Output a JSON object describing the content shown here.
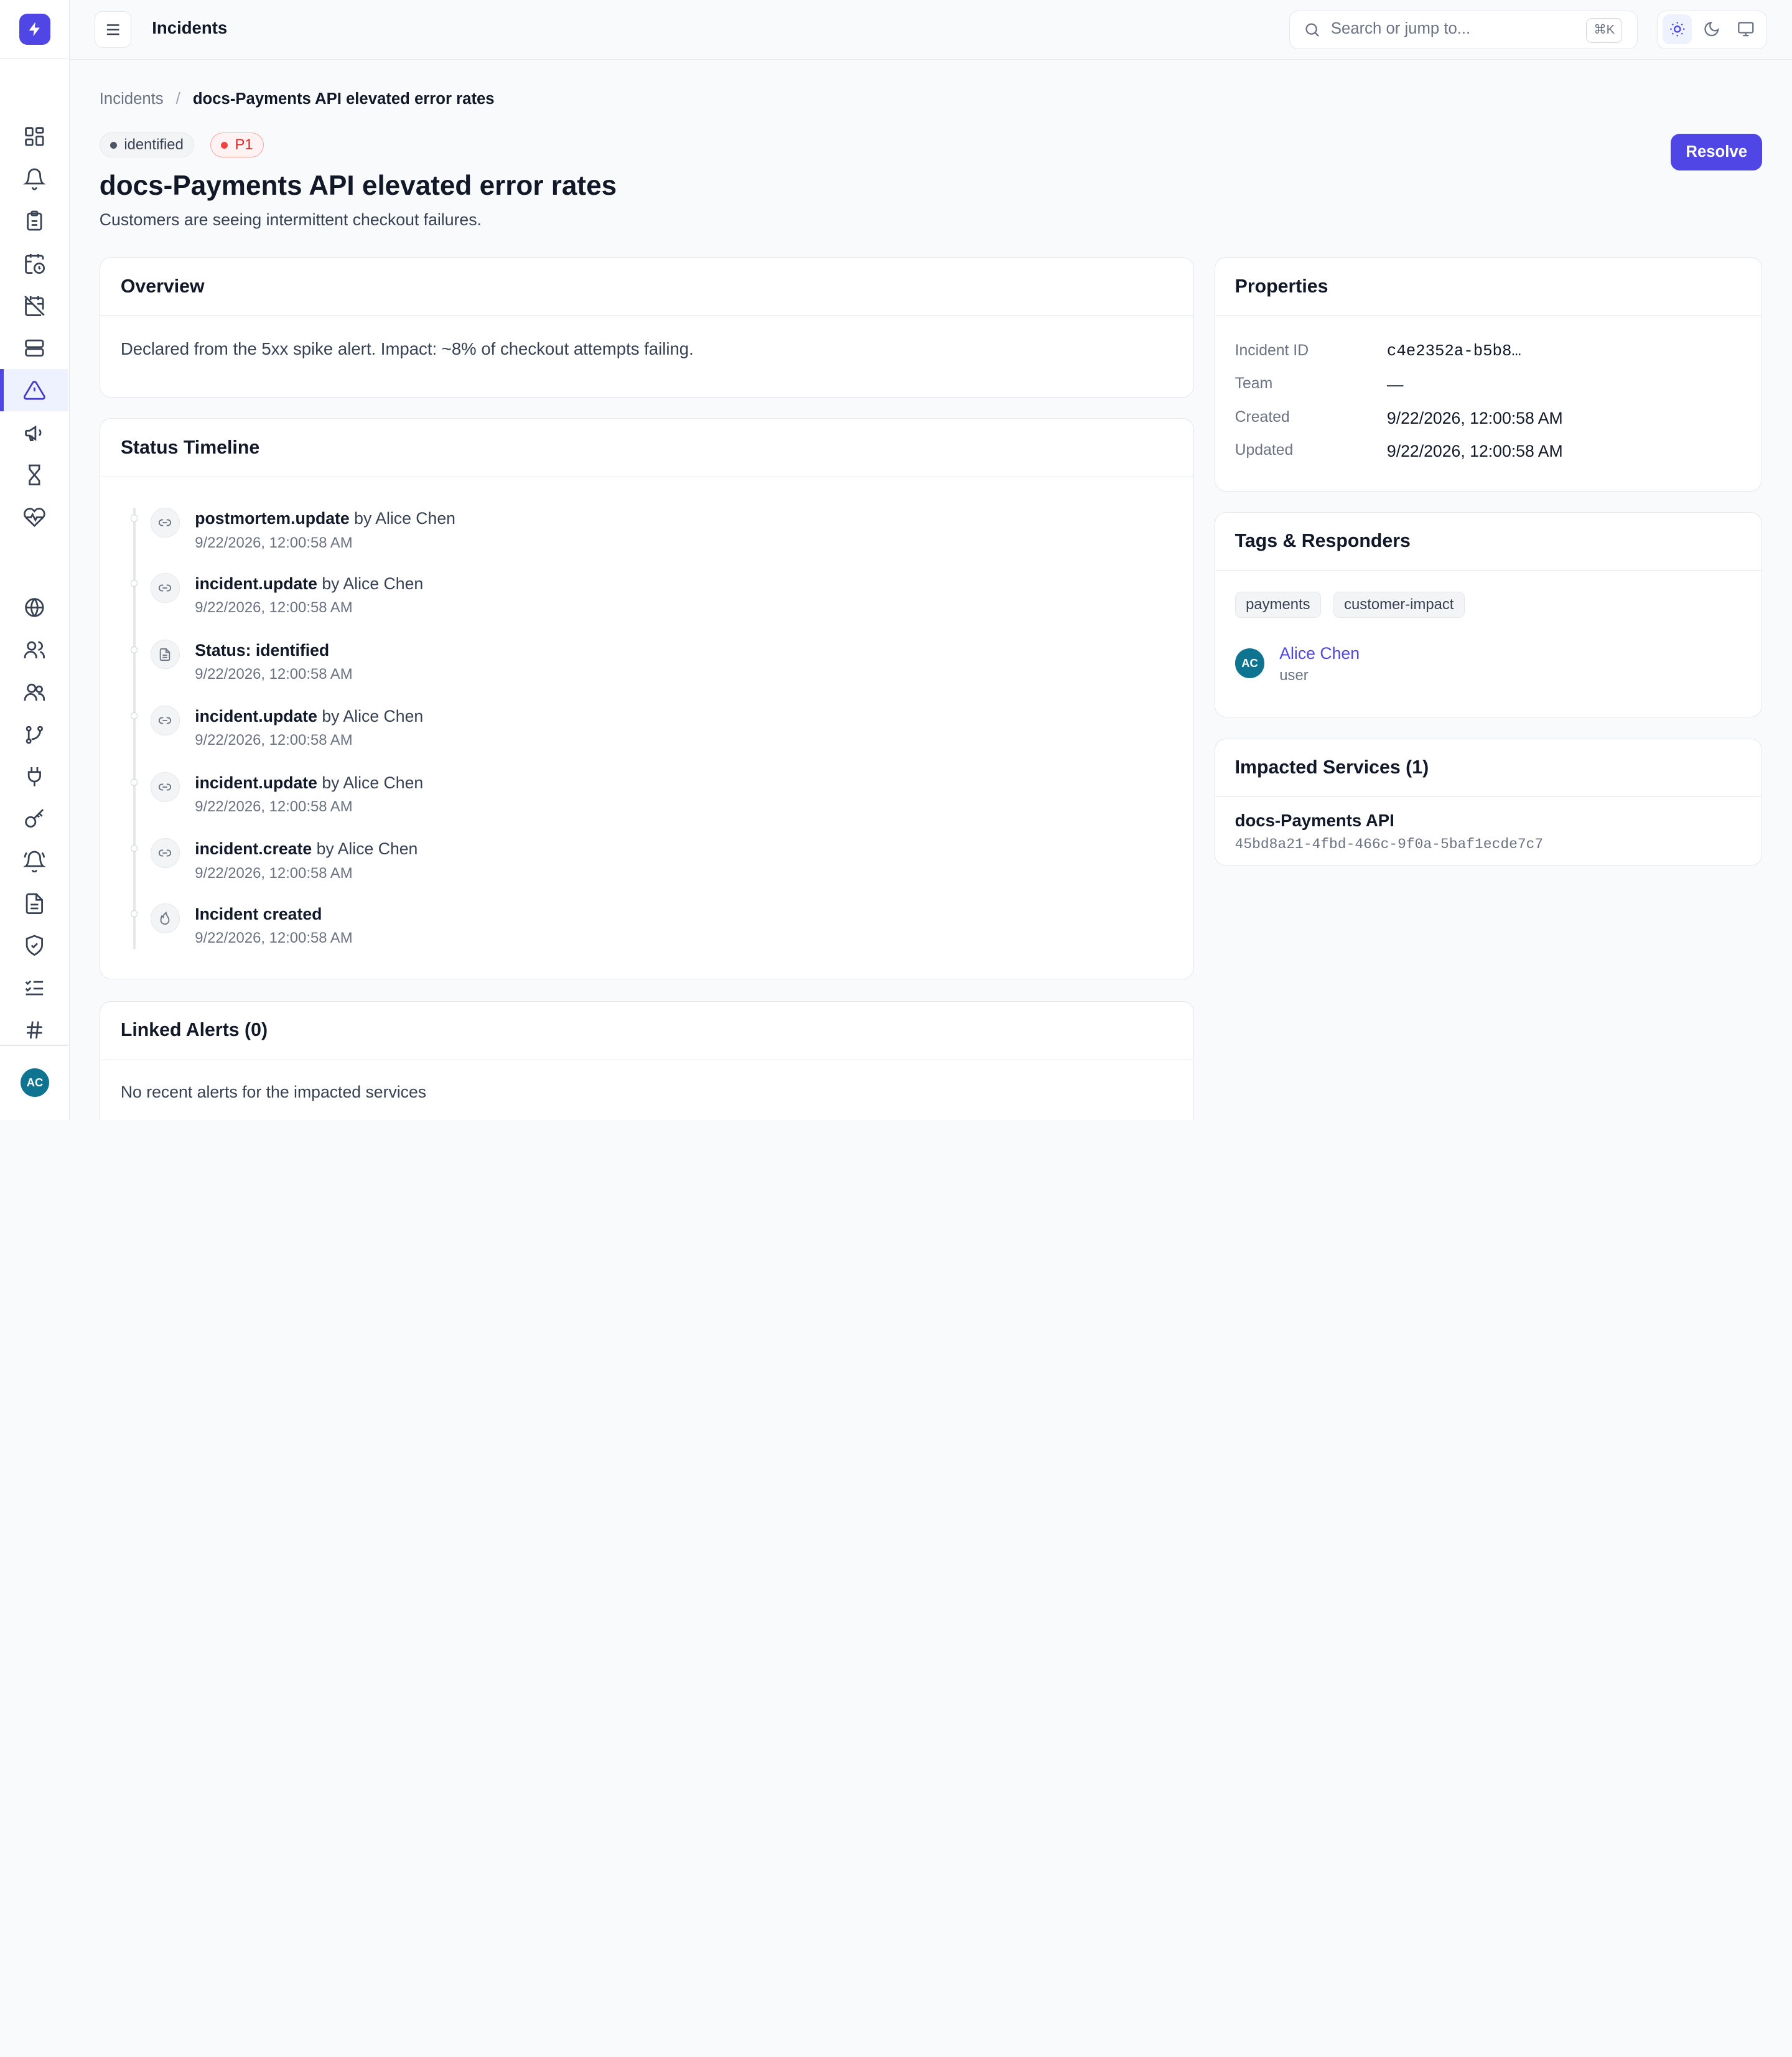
{
  "header": {
    "title": "Incidents",
    "search_placeholder": "Search or jump to...",
    "search_shortcut": "⌘K"
  },
  "breadcrumb": {
    "parent": "Incidents",
    "separator": "/",
    "current": "docs-Payments API elevated error rates"
  },
  "incident": {
    "status": "identified",
    "severity": "P1",
    "title": "docs-Payments API elevated error rates",
    "description": "Customers are seeing intermittent checkout failures.",
    "resolve_label": "Resolve"
  },
  "overview": {
    "heading": "Overview",
    "text": "Declared from the 5xx spike alert. Impact: ~8% of checkout attempts failing."
  },
  "timeline": {
    "heading": "Status Timeline",
    "items": [
      {
        "event": "postmortem.update",
        "by": "by Alice Chen",
        "time": "9/22/2026, 12:00:58 AM",
        "icon": "link-icon"
      },
      {
        "event": "incident.update",
        "by": "by Alice Chen",
        "time": "9/22/2026, 12:00:58 AM",
        "icon": "link-icon"
      },
      {
        "event": "Status: identified",
        "by": "",
        "time": "9/22/2026, 12:00:58 AM",
        "icon": "document-icon"
      },
      {
        "event": "incident.update",
        "by": "by Alice Chen",
        "time": "9/22/2026, 12:00:58 AM",
        "icon": "link-icon"
      },
      {
        "event": "incident.update",
        "by": "by Alice Chen",
        "time": "9/22/2026, 12:00:58 AM",
        "icon": "link-icon"
      },
      {
        "event": "incident.create",
        "by": "by Alice Chen",
        "time": "9/22/2026, 12:00:58 AM",
        "icon": "link-icon"
      },
      {
        "event": "Incident created",
        "by": "",
        "time": "9/22/2026, 12:00:58 AM",
        "icon": "flame-icon"
      }
    ]
  },
  "linked_alerts": {
    "heading": "Linked Alerts (0)",
    "empty": "No recent alerts for the impacted services"
  },
  "properties": {
    "heading": "Properties",
    "rows": [
      {
        "label": "Incident ID",
        "value": "c4e2352a-b5b8…"
      },
      {
        "label": "Team",
        "value": "—"
      },
      {
        "label": "Created",
        "value": "9/22/2026, 12:00:58 AM"
      },
      {
        "label": "Updated",
        "value": "9/22/2026, 12:00:58 AM"
      }
    ]
  },
  "tags_responders": {
    "heading": "Tags & Responders",
    "tags": [
      "payments",
      "customer-impact"
    ],
    "responder": {
      "initials": "AC",
      "name": "Alice Chen",
      "role": "user"
    }
  },
  "impacted_services": {
    "heading": "Impacted Services (1)",
    "service_name": "docs-Payments API",
    "service_id": "45bd8a21-4fbd-466c-9f0a-5baf1ecde7c7"
  },
  "sidebar": {
    "avatar_initials": "AC",
    "icons": [
      "dashboard-icon",
      "bell-icon",
      "clipboard-icon",
      "calendar-clock-icon",
      "calendar-off-icon",
      "server-icon",
      "alert-triangle-icon",
      "megaphone-icon",
      "hourglass-icon",
      "heart-pulse-icon",
      "globe-icon",
      "users-icon",
      "team-icon",
      "git-branch-icon",
      "plug-icon",
      "key-icon",
      "bell-ring-icon",
      "file-text-icon",
      "shield-check-icon",
      "list-checks-icon",
      "hash-icon"
    ]
  },
  "colors": {
    "accent": "#4f46e5",
    "severity_red": "#dc2626",
    "avatar_teal": "#0e7490"
  }
}
